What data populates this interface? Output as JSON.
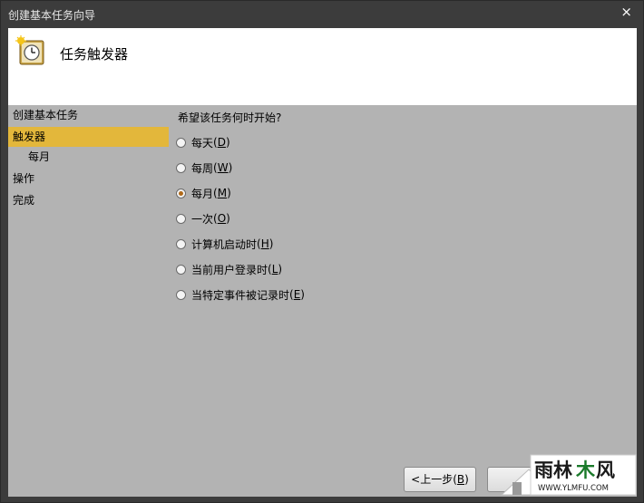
{
  "window": {
    "title": "创建基本任务向导",
    "close_glyph": "×"
  },
  "header": {
    "title": "任务触发器",
    "icon": "task-clock-icon"
  },
  "nav": {
    "items": [
      {
        "label": "创建基本任务"
      },
      {
        "label": "触发器",
        "active": true
      },
      {
        "label": "每月",
        "sub": true
      },
      {
        "label": "操作"
      },
      {
        "label": "完成"
      }
    ]
  },
  "main": {
    "question": "希望该任务何时开始?",
    "options": [
      {
        "label": "每天",
        "mnemonic": "D",
        "selected": false
      },
      {
        "label": "每周",
        "mnemonic": "W",
        "selected": false
      },
      {
        "label": "每月",
        "mnemonic": "M",
        "selected": true
      },
      {
        "label": "一次",
        "mnemonic": "O",
        "selected": false
      },
      {
        "label": "计算机启动时",
        "mnemonic": "H",
        "selected": false
      },
      {
        "label": "当前用户登录时",
        "mnemonic": "L",
        "selected": false
      },
      {
        "label": "当特定事件被记录时",
        "mnemonic": "E",
        "selected": false
      }
    ]
  },
  "footer": {
    "back_label": "<上一步(",
    "back_mnemonic": "B",
    "back_suffix": ")"
  },
  "watermark": {
    "brand": "雨林木风",
    "url": "WWW.YLMFU.COM"
  }
}
